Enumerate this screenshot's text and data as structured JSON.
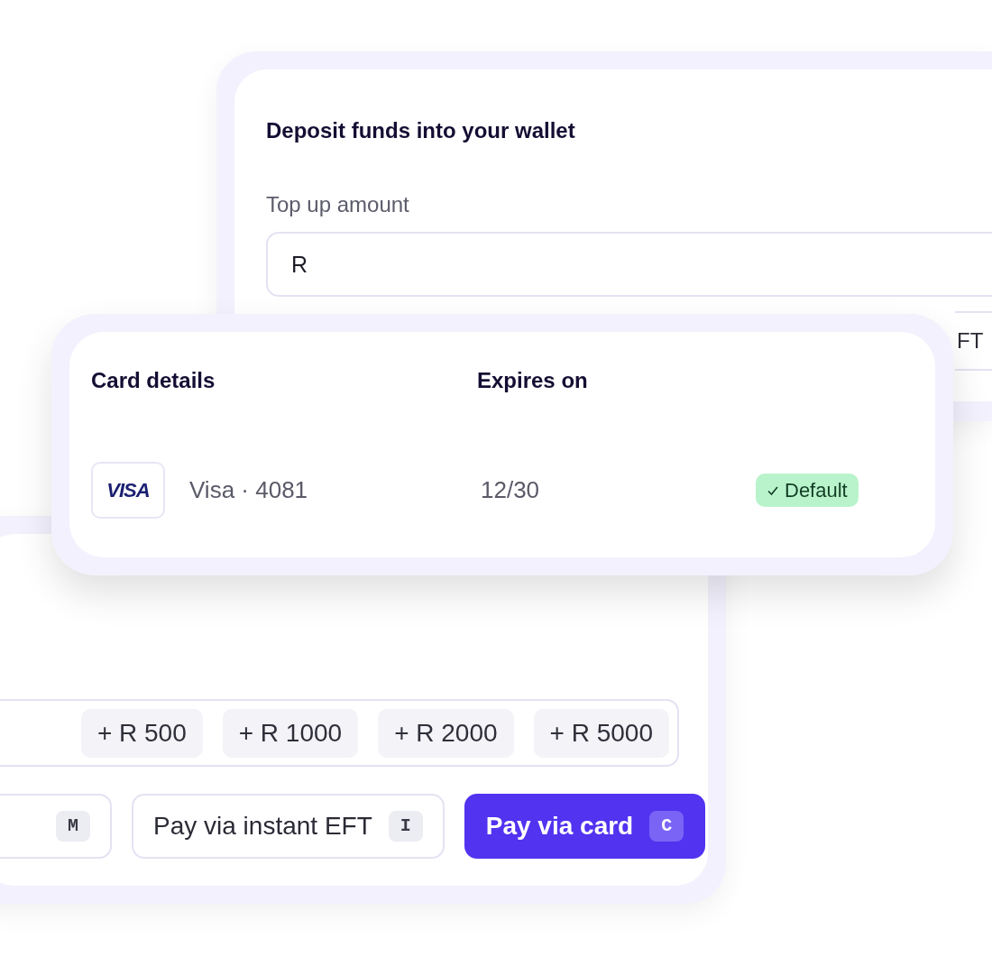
{
  "wallet_card": {
    "title": "Deposit funds into your wallet",
    "amount_label": "Top up amount",
    "amount_value": "R",
    "partial_button": "FT"
  },
  "cards_panel": {
    "columns": [
      "Card details",
      "Expires on"
    ],
    "cards": [
      {
        "brand": "VISA",
        "label": "Visa · 4081",
        "expires": "12/30",
        "default": true,
        "badge": "Default"
      }
    ]
  },
  "payment_panel": {
    "presets": [
      "+ R 500",
      "+ R 1000",
      "+ R 2000",
      "+ R 5000"
    ],
    "actions": [
      {
        "shortcut": "M",
        "kind": "secondary"
      },
      {
        "label": "Pay via instant EFT",
        "shortcut": "I",
        "kind": "secondary"
      },
      {
        "label": "Pay via card",
        "shortcut": "C",
        "kind": "primary"
      }
    ]
  }
}
